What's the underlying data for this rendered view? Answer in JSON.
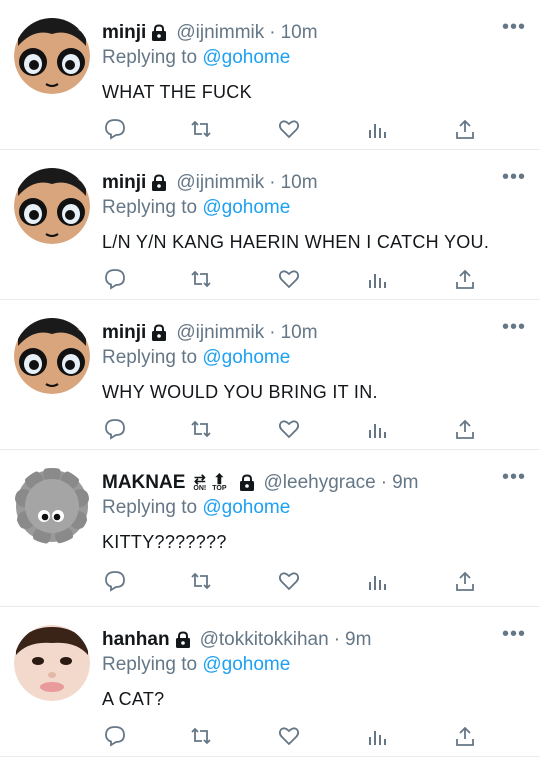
{
  "colors": {
    "link": "#1da1f2",
    "muted": "#657786",
    "text": "#14171a",
    "divider": "#e6ecf0"
  },
  "icons": {
    "lock": "lock-icon",
    "more": "more-icon",
    "reply": "reply-icon",
    "retweet": "retweet-icon",
    "like": "heart-icon",
    "analytics": "analytics-icon",
    "share": "share-icon"
  },
  "more_label": "•••",
  "replying_prefix": "Replying to",
  "tweets": [
    {
      "name": "minji",
      "handle": "@ijnimmik",
      "time": "10m",
      "mention": "@gohome",
      "text": "WHAT THE FUCK"
    },
    {
      "name": "minji",
      "handle": "@ijnimmik",
      "time": "10m",
      "mention": "@gohome",
      "text": "L/N Y/N KANG HAERIN WHEN I CATCH YOU."
    },
    {
      "name": "minji",
      "handle": "@ijnimmik",
      "time": "10m",
      "mention": "@gohome",
      "text": "WHY WOULD YOU BRING IT IN."
    },
    {
      "name": "MAKNAE",
      "handle": "@leehygrace",
      "time": "9m",
      "mention": "@gohome",
      "text": "KITTY???????",
      "badges": [
        {
          "glyph": "⇄",
          "label": "ON!"
        },
        {
          "glyph": "⬆",
          "label": "TOP"
        }
      ]
    },
    {
      "name": "hanhan",
      "handle": "@tokkitokkihan",
      "time": "9m",
      "mention": "@gohome",
      "text": "A CAT?"
    }
  ]
}
